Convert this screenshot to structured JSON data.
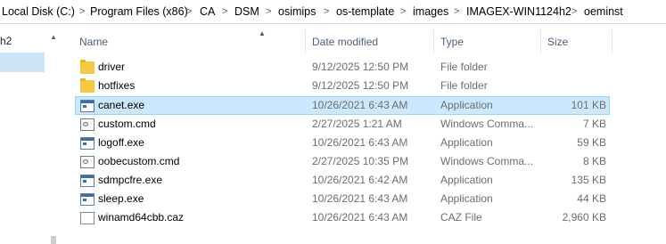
{
  "breadcrumb": {
    "items": [
      "Local Disk (C:)",
      "Program Files (x86)",
      "CA",
      "DSM",
      "osimips",
      "os-template",
      "images",
      "IMAGEX-WIN1124h2",
      "oeminst"
    ],
    "separator": ">"
  },
  "nav": {
    "items": [
      "h2",
      ""
    ]
  },
  "columns": {
    "name": "Name",
    "date": "Date modified",
    "type": "Type",
    "size": "Size"
  },
  "files": [
    {
      "name": "driver",
      "date": "9/12/2025 12:50 PM",
      "type": "File folder",
      "size": "",
      "icon": "folder-icon"
    },
    {
      "name": "hotfixes",
      "date": "9/12/2025 12:50 PM",
      "type": "File folder",
      "size": "",
      "icon": "folder-icon"
    },
    {
      "name": "canet.exe",
      "date": "10/26/2021 6:43 AM",
      "type": "Application",
      "size": "101 KB",
      "icon": "application-icon",
      "selected": true
    },
    {
      "name": "custom.cmd",
      "date": "2/27/2025 1:21 AM",
      "type": "Windows Comma...",
      "size": "7 KB",
      "icon": "command-script-icon"
    },
    {
      "name": "logoff.exe",
      "date": "10/26/2021 6:43 AM",
      "type": "Application",
      "size": "59 KB",
      "icon": "application-icon"
    },
    {
      "name": "oobecustom.cmd",
      "date": "2/27/2025 10:35 PM",
      "type": "Windows Comma...",
      "size": "8 KB",
      "icon": "command-script-icon"
    },
    {
      "name": "sdmpcfre.exe",
      "date": "10/26/2021 6:42 AM",
      "type": "Application",
      "size": "135 KB",
      "icon": "application-icon"
    },
    {
      "name": "sleep.exe",
      "date": "10/26/2021 6:43 AM",
      "type": "Application",
      "size": "44 KB",
      "icon": "application-icon"
    },
    {
      "name": "winamd64cbb.caz",
      "date": "10/26/2021 6:43 AM",
      "type": "CAZ File",
      "size": "2,960 KB",
      "icon": "generic-file-icon"
    }
  ],
  "colors": {
    "selection_bg": "#cce8ff",
    "selection_border": "#99d1ff",
    "nav_selection_bg": "#cce4f7",
    "header_text": "#4c607a",
    "folder": "#f5c842"
  }
}
